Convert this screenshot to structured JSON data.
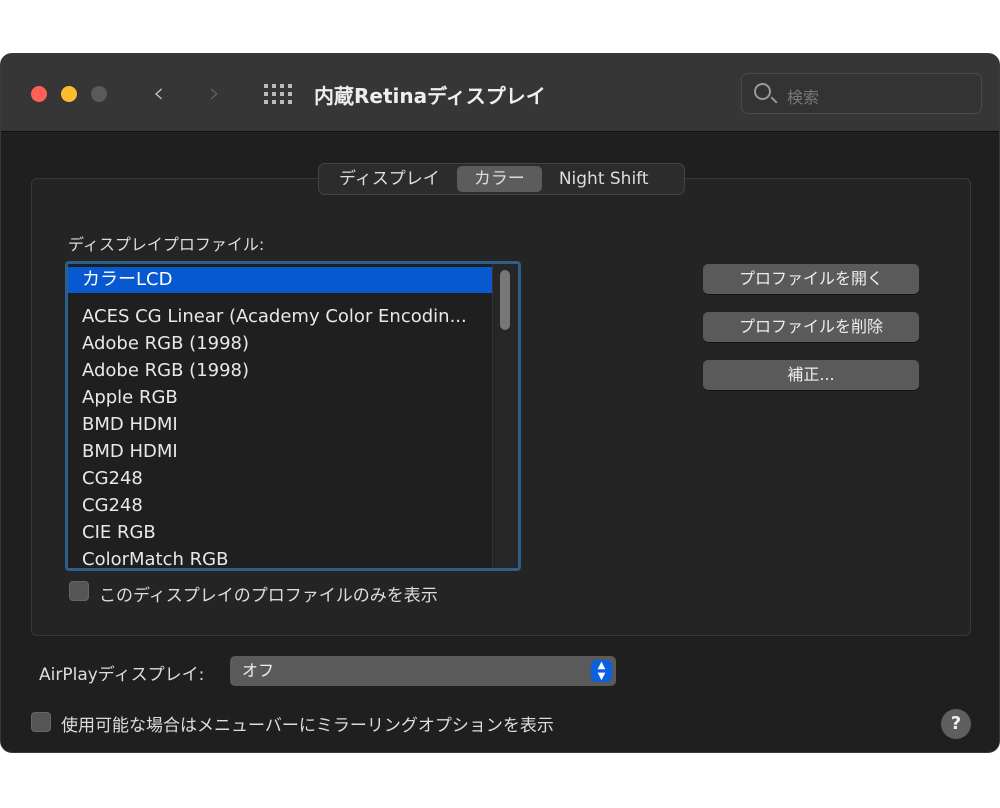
{
  "window": {
    "title": "内蔵Retinaディスプレイ",
    "search_placeholder": "検索"
  },
  "tabs": [
    {
      "label": "ディスプレイ",
      "selected": false
    },
    {
      "label": "カラー",
      "selected": true
    },
    {
      "label": "Night Shift",
      "selected": false
    }
  ],
  "profiles": {
    "label": "ディスプレイプロファイル:",
    "selected": "カラーLCD",
    "items": [
      "ACES CG Linear (Academy Color Encodin...",
      "Adobe RGB (1998)",
      "Adobe RGB (1998)",
      "Apple RGB",
      "BMD HDMI",
      "BMD HDMI",
      "CG248",
      "CG248",
      "CIE RGB",
      "ColorMatch RGB"
    ],
    "only_this_display_label": "このディスプレイのプロファイルのみを表示",
    "only_this_display_checked": false
  },
  "buttons": {
    "open": "プロファイルを開く",
    "delete": "プロファイルを削除",
    "calibrate": "補正..."
  },
  "airplay": {
    "label": "AirPlayディスプレイ:",
    "value": "オフ"
  },
  "mirror": {
    "label": "使用可能な場合はメニューバーにミラーリングオプションを表示",
    "checked": false
  },
  "help": "?",
  "colors": {
    "accent": "#0858d0",
    "focus_ring": "#2b5f8c"
  }
}
